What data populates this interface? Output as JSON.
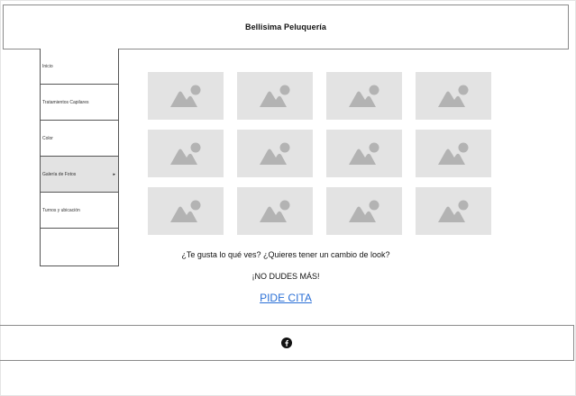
{
  "header": {
    "title": "Bellisima Peluquería"
  },
  "sidebar": {
    "items": [
      {
        "label": "Inicio"
      },
      {
        "label": "Tratamientos Capilares"
      },
      {
        "label": "Color"
      },
      {
        "label": "Galería de Fotos",
        "active": true,
        "arrow": "▸"
      },
      {
        "label": "Turnos y ubicación"
      }
    ]
  },
  "gallery": {
    "rows": 3,
    "columns": 4,
    "placeholder_icon": "image-placeholder-icon"
  },
  "promo": {
    "question": "¿Te gusta lo qué ves? ¿Quieres tener un cambio de look?",
    "cta": "¡NO DUDES MÁS!",
    "link": "PIDE CITA"
  },
  "footer": {
    "icon": "facebook-icon"
  },
  "colors": {
    "link": "#2a6fd6",
    "placeholder_bg": "#e3e3e3",
    "placeholder_icon": "#b3b3b3",
    "active_nav": "#e3e3e3"
  }
}
